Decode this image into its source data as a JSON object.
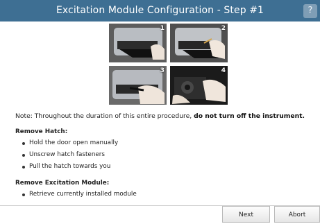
{
  "window": {
    "title": "Excitation Module Configuration - Step #1",
    "help_label": "?"
  },
  "photos": [
    {
      "label": "1",
      "description_icon": "printer-door-photo"
    },
    {
      "label": "2",
      "description_icon": "unscrew-photo"
    },
    {
      "label": "3",
      "description_icon": "pull-hatch-photo"
    },
    {
      "label": "4",
      "description_icon": "module-photo"
    }
  ],
  "note": {
    "prefix": "Note: Throughout the duration of this entire procedure, ",
    "emphasis": "do not turn off the instrument."
  },
  "sections": [
    {
      "heading": "Remove Hatch:",
      "items": [
        "Hold the door open manually",
        "Unscrew hatch fasteners",
        "Pull the hatch towards you"
      ]
    },
    {
      "heading": "Remove Excitation Module:",
      "items": [
        "Retrieve currently installed module"
      ]
    }
  ],
  "buttons": {
    "next": "Next",
    "abort": "Abort"
  },
  "colors": {
    "titlebar": "#3e6f93",
    "help_button": "#7f9eb6"
  }
}
